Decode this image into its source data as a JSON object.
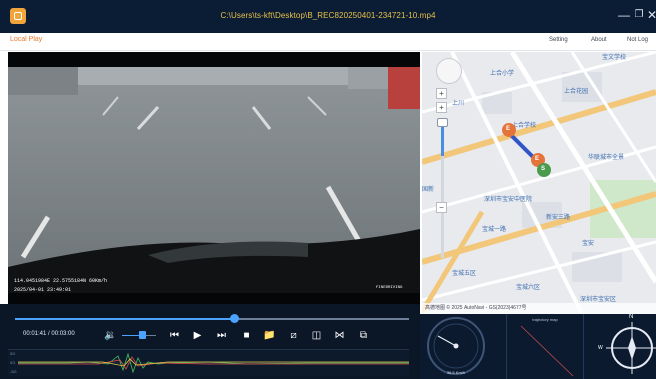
{
  "window": {
    "title": "C:\\Users\\ts-kft\\Desktop\\B_REC820250401-234721-10.mp4"
  },
  "menu": {
    "tab_local": "Local Play",
    "setting": "Setting",
    "about": "About",
    "not_log": "Not Log"
  },
  "video": {
    "overlay_line1": "114.0451984E   22.5755184N   60Km/h",
    "overlay_line2": "2025/04-01   23:49:01",
    "watermark": "FINEDRIVING"
  },
  "map": {
    "labels": {
      "top_right": "宝文学校",
      "school_a": "上合小学",
      "park": "上合花园",
      "shanghe": "上川",
      "school_b": "上合学校",
      "city_center": "华联城市全景",
      "hospital": "深圳市宝安中医院",
      "left_edge": "国新",
      "xinan": "新安三路",
      "baocheng": "宝城一路",
      "station_a": "宝城五区",
      "station_b": "宝城六区",
      "bottom": "深圳市宝安区",
      "baoan": "宝安"
    },
    "attribution": "高德地图   © 2025 AutoNavi - GS(2023)4677号",
    "markers": {
      "start": "S",
      "end_a": "E",
      "end_b": "E"
    }
  },
  "player": {
    "current_time": "00:01:41",
    "total_time": "00:03:00",
    "time_display": "00:01:41 / 00:03:00",
    "progress_fraction": 0.555,
    "volume_fraction": 0.6,
    "graph_labels": [
      "5G",
      "0G",
      "-5G"
    ]
  },
  "gauges": {
    "speedometer_readout": "36.5 Km/h",
    "trajectory_title": "trajectory map",
    "compass_north": "N",
    "compass_west": "W"
  },
  "colors": {
    "titlebar": "#0b1c35",
    "title_text": "#e8c247",
    "accent": "#e87a2d",
    "progress": "#4aa3ff",
    "route": "#2f55c9"
  }
}
